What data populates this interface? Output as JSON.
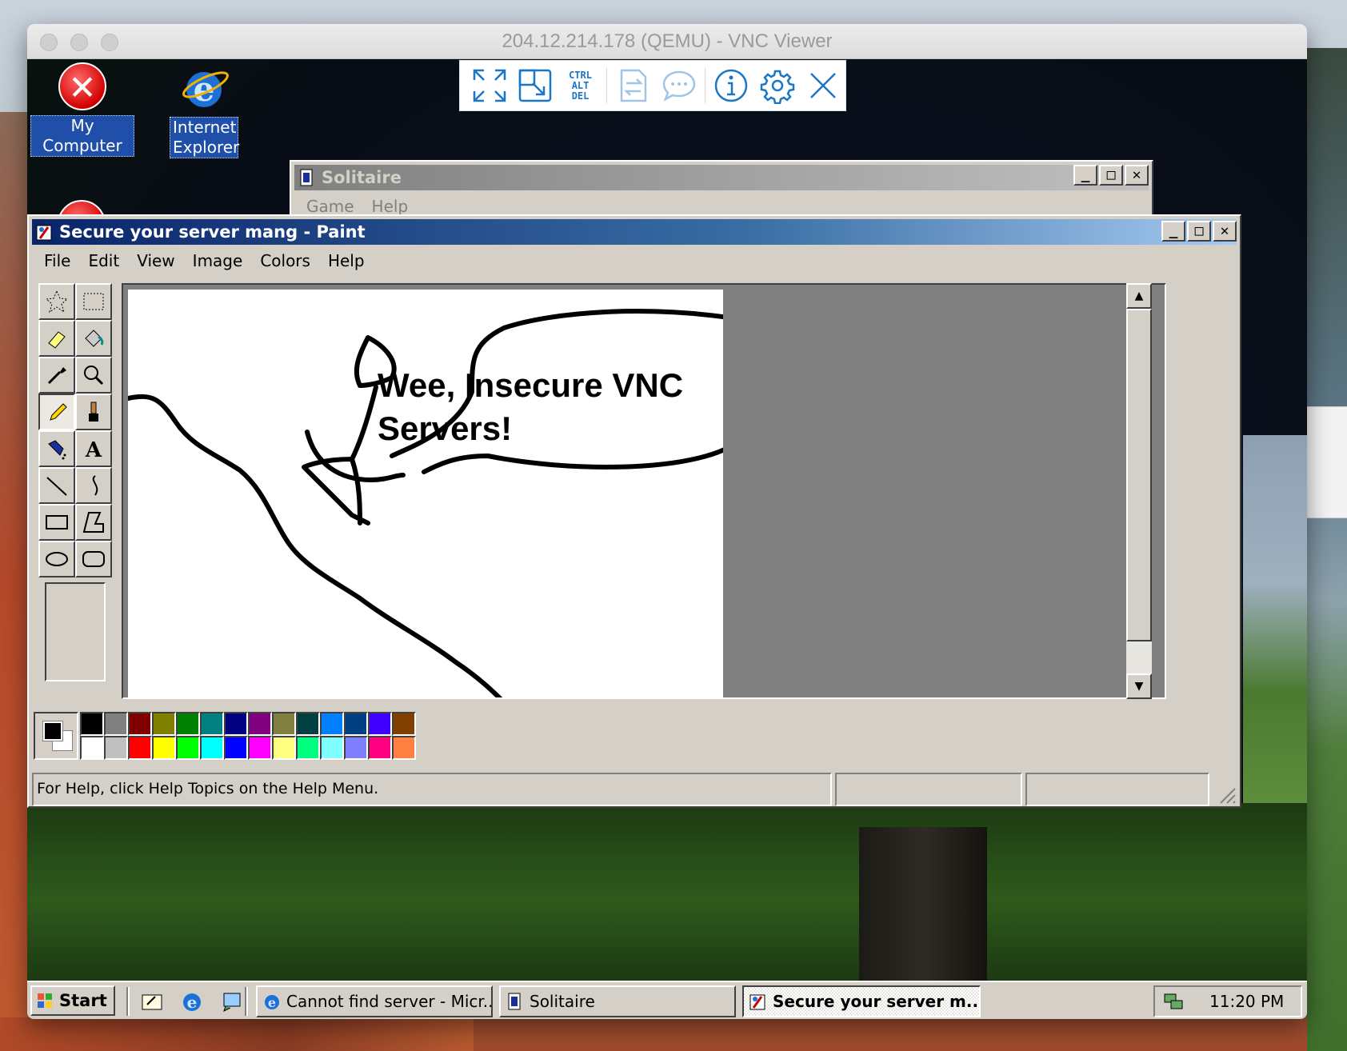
{
  "vnc": {
    "title": "204.12.214.178 (QEMU) - VNC Viewer",
    "toolbar": {
      "ctrl": "CTRL",
      "alt": "ALT",
      "del": "DEL",
      "icons": [
        "fullscreen-icon",
        "scale-icon",
        "ctrl-alt-del-icon",
        "transfer-icon",
        "chat-icon",
        "info-icon",
        "settings-icon",
        "close-icon"
      ]
    }
  },
  "desktop": {
    "icons": [
      {
        "label": "My Computer",
        "icon": "error-icon"
      },
      {
        "label": "Internet Explorer",
        "icon": "internet-explorer-icon"
      }
    ]
  },
  "solitaire": {
    "title": "Solitaire",
    "menu": [
      "Game",
      "Help"
    ]
  },
  "paint": {
    "title": "Secure your server mang - Paint",
    "menu": [
      "File",
      "Edit",
      "View",
      "Image",
      "Colors",
      "Help"
    ],
    "tools": [
      "free-select",
      "select",
      "eraser",
      "fill",
      "pick-color",
      "magnifier",
      "pencil",
      "brush",
      "airbrush",
      "text",
      "line",
      "curve",
      "rectangle",
      "polygon",
      "ellipse",
      "rounded-rectangle"
    ],
    "active_tool": "pencil",
    "canvas_text_line1": "Wee, Insecure VNC",
    "canvas_text_line2": "Servers!",
    "palette_top": [
      "#000000",
      "#808080",
      "#800000",
      "#808000",
      "#008000",
      "#008080",
      "#000080",
      "#800080",
      "#808040",
      "#004040",
      "#0080ff",
      "#004080",
      "#4000ff",
      "#804000"
    ],
    "palette_bottom": [
      "#ffffff",
      "#c0c0c0",
      "#ff0000",
      "#ffff00",
      "#00ff00",
      "#00ffff",
      "#0000ff",
      "#ff00ff",
      "#ffff80",
      "#00ff80",
      "#80ffff",
      "#8080ff",
      "#ff0080",
      "#ff8040"
    ],
    "foreground": "#000000",
    "background": "#ffffff",
    "status": "For Help, click Help Topics on the Help Menu."
  },
  "taskbar": {
    "start": "Start",
    "tasks": [
      {
        "label": "Cannot find server - Micr...",
        "icon": "internet-explorer-icon"
      },
      {
        "label": "Solitaire",
        "icon": "solitaire-icon"
      },
      {
        "label": "Secure your server m...",
        "icon": "paint-icon",
        "active": true
      }
    ],
    "clock": "11:20 PM"
  }
}
